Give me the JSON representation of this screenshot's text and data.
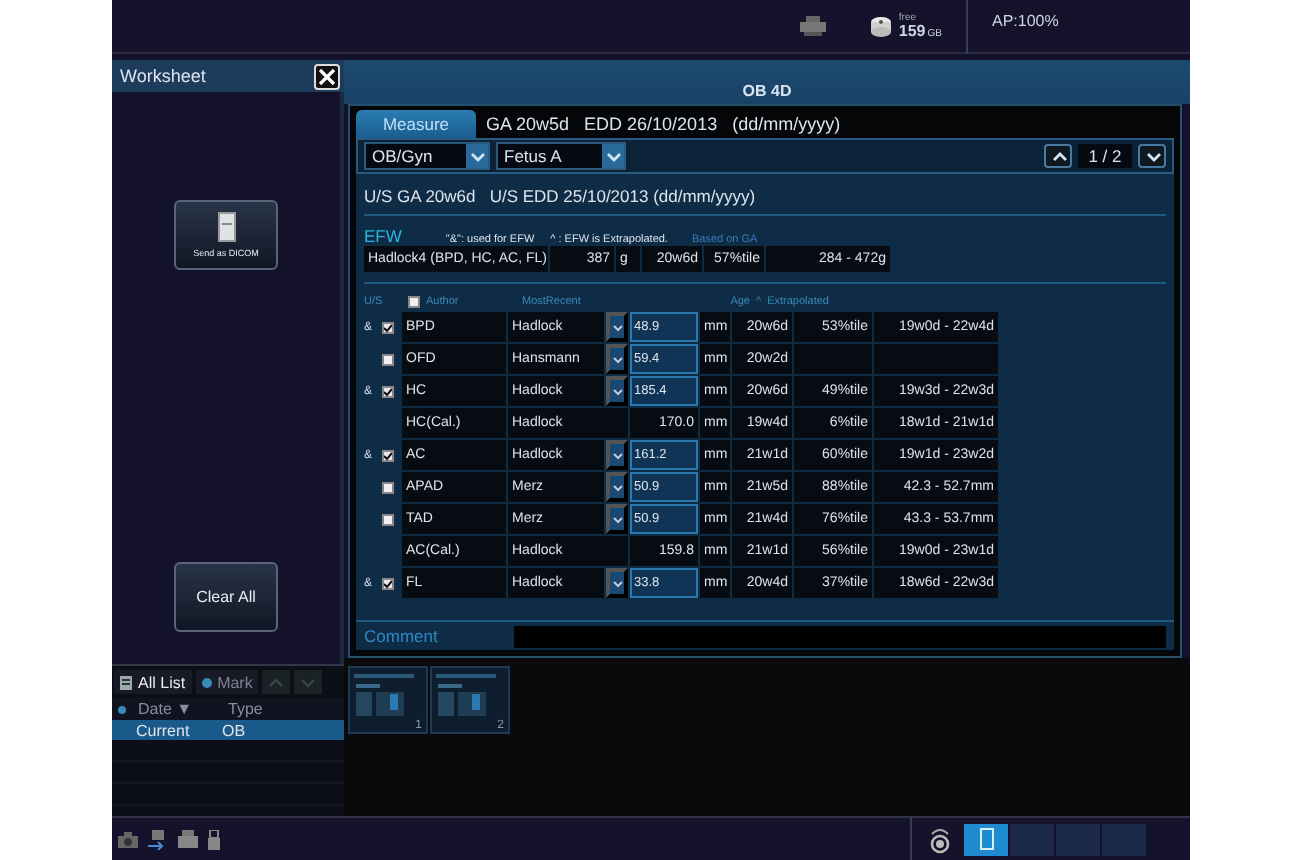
{
  "status_bar": {
    "storage_label": "free",
    "storage_value": "159",
    "storage_unit": "GB",
    "acoustic_power": "AP:100%"
  },
  "sidebar": {
    "title": "Worksheet",
    "send_button": "Send as DICOM",
    "clear_button": "Clear All",
    "list": {
      "tabs": [
        {
          "label": "All List",
          "selected": true
        },
        {
          "label": "Mark",
          "selected": false
        }
      ],
      "columns": [
        "Date ▼",
        "Type"
      ],
      "rows": [
        {
          "date": "Current",
          "type": "OB",
          "selected": true
        }
      ]
    }
  },
  "worksheet": {
    "title": "OB 4D",
    "tabs": [
      {
        "label": "Measure",
        "selected": true
      }
    ],
    "summary": "GA 20w5d   EDD 26/10/2013   (dd/mm/yyyy)",
    "application": "OB/Gyn",
    "fetus": "Fetus A",
    "page": "1 / 2",
    "us_summary": "U/S GA 20w6d   U/S EDD 25/10/2013 (dd/mm/yyyy)",
    "efw": {
      "title": "EFW",
      "note_used": "\"&\": used for EFW",
      "note_extrapolated": "^ : EFW is Extrapolated.",
      "basis": "Based on GA",
      "formula": "Hadlock4 (BPD, HC, AC, FL)",
      "weight": "387",
      "unit": "g",
      "age": "20w6d",
      "percentile": "57%tile",
      "range": "284 - 472g"
    },
    "table": {
      "columns": [
        "U/S",
        "Author",
        "MostRecent",
        "Age",
        "^",
        "Extrapolated"
      ],
      "header_checked": false,
      "rows": [
        {
          "kind": "measured",
          "efw_mark": "&",
          "checked": true,
          "name": "BPD",
          "author": "Hadlock",
          "value": "48.9",
          "unit": "mm",
          "age": "20w6d",
          "percentile": "53%tile",
          "range": "19w0d - 22w4d"
        },
        {
          "kind": "measured",
          "checked": false,
          "name": "OFD",
          "author": "Hansmann",
          "value": "59.4",
          "unit": "mm",
          "age": "20w2d"
        },
        {
          "kind": "measured",
          "efw_mark": "&",
          "checked": true,
          "name": "HC",
          "author": "Hadlock",
          "value": "185.4",
          "unit": "mm",
          "age": "20w6d",
          "percentile": "49%tile",
          "range": "19w3d - 22w3d"
        },
        {
          "kind": "calculated",
          "name": "HC(Cal.)",
          "author": "Hadlock",
          "value": "170.0",
          "unit": "mm",
          "age": "19w4d",
          "percentile": "6%tile",
          "range": "18w1d - 21w1d"
        },
        {
          "kind": "measured",
          "efw_mark": "&",
          "checked": true,
          "name": "AC",
          "author": "Hadlock",
          "value": "161.2",
          "unit": "mm",
          "age": "21w1d",
          "percentile": "60%tile",
          "range": "19w1d - 23w2d"
        },
        {
          "kind": "measured",
          "checked": false,
          "name": "APAD",
          "author": "Merz",
          "value": "50.9",
          "unit": "mm",
          "age": "21w5d",
          "percentile": "88%tile",
          "range": "42.3 - 52.7mm"
        },
        {
          "kind": "measured",
          "checked": false,
          "name": "TAD",
          "author": "Merz",
          "value": "50.9",
          "unit": "mm",
          "age": "21w4d",
          "percentile": "76%tile",
          "range": "43.3 - 53.7mm"
        },
        {
          "kind": "calculated",
          "name": "AC(Cal.)",
          "author": "Hadlock",
          "value": "159.8",
          "unit": "mm",
          "age": "21w1d",
          "percentile": "56%tile",
          "range": "19w0d - 23w1d"
        },
        {
          "kind": "measured",
          "efw_mark": "&",
          "checked": true,
          "name": "FL",
          "author": "Hadlock",
          "value": "33.8",
          "unit": "mm",
          "age": "20w4d",
          "percentile": "37%tile",
          "range": "18w6d - 22w3d"
        }
      ]
    },
    "comment_label": "Comment"
  },
  "thumbnails": [
    {
      "number": "1"
    },
    {
      "number": "2"
    }
  ],
  "tool_buttons": [
    {
      "selected": true
    },
    {
      "selected": false
    },
    {
      "selected": false
    },
    {
      "selected": false
    }
  ]
}
